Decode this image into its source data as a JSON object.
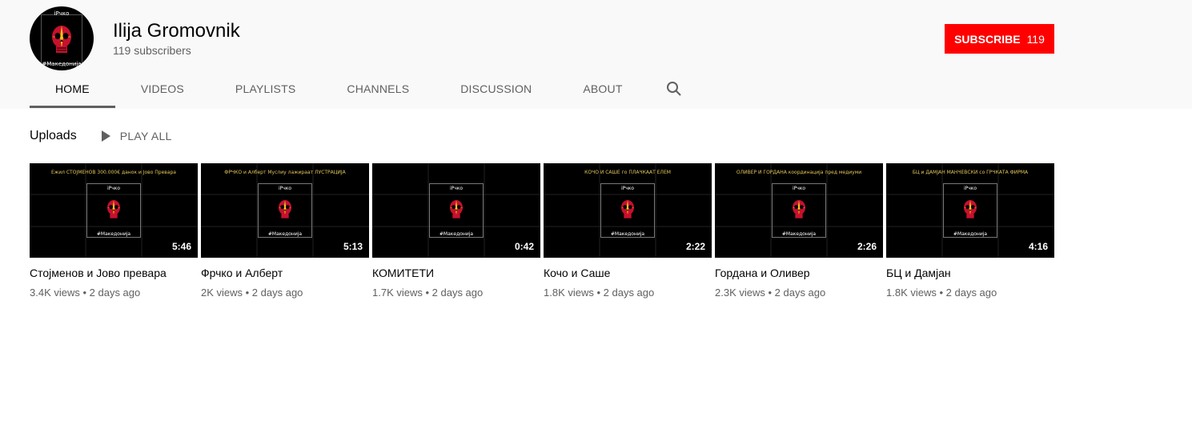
{
  "channel": {
    "name": "Ilija Gromovnik",
    "subscribers": "119 subscribers",
    "avatar_top_text": "iPчко",
    "avatar_bottom_text": "#Македонија"
  },
  "subscribe": {
    "label": "SUBSCRIBE",
    "count": "119",
    "color": "#ff0000"
  },
  "tabs": [
    {
      "label": "HOME",
      "active": true
    },
    {
      "label": "VIDEOS"
    },
    {
      "label": "PLAYLISTS"
    },
    {
      "label": "CHANNELS"
    },
    {
      "label": "DISCUSSION"
    },
    {
      "label": "ABOUT"
    }
  ],
  "search_icon": "search-icon",
  "uploads": {
    "title": "Uploads",
    "play_all": "PLAY ALL"
  },
  "videos": [
    {
      "caption": "Ежил СТОЈМЕНОВ 300.000€ данок и Јово Преварa",
      "top": "iPчко",
      "bottom": "#Македонија",
      "duration": "5:46",
      "title": "Стојменов и Јово преварa",
      "meta": "3.4K views • 2 days ago"
    },
    {
      "caption": "ФРЧКО и Алберт Муслиу лажираат ЛУСТРАЦИЈА",
      "top": "iPчко",
      "bottom": "#Македонија",
      "duration": "5:13",
      "title": "Фрчко и Алберт",
      "meta": "2K views • 2 days ago"
    },
    {
      "caption": "",
      "top": "iPчко",
      "bottom": "#Македонија",
      "duration": "0:42",
      "title": "КОМИТЕТИ",
      "meta": "1.7K views • 2 days ago"
    },
    {
      "caption": "КОЧО И САШЕ го ПЛАЧКААТ ЕЛЕМ",
      "top": "iPчко",
      "bottom": "#Македонија",
      "duration": "2:22",
      "title": "Кочо и Саше",
      "meta": "1.8K views • 2 days ago"
    },
    {
      "caption": "ОЛИВЕР И ГОРДАНА координација пред медиуми",
      "top": "iPчко",
      "bottom": "#Македонија",
      "duration": "2:26",
      "title": "Гордана и Оливер",
      "meta": "2.3K views • 2 days ago"
    },
    {
      "caption": "БЦ и ДАМЈАН МАНЧЕВСКИ со ГРЧКАТА ФИРМА",
      "top": "iPчко",
      "bottom": "#Македонија",
      "duration": "4:16",
      "title": "БЦ и Дамјан",
      "meta": "1.8K views • 2 days ago"
    }
  ]
}
